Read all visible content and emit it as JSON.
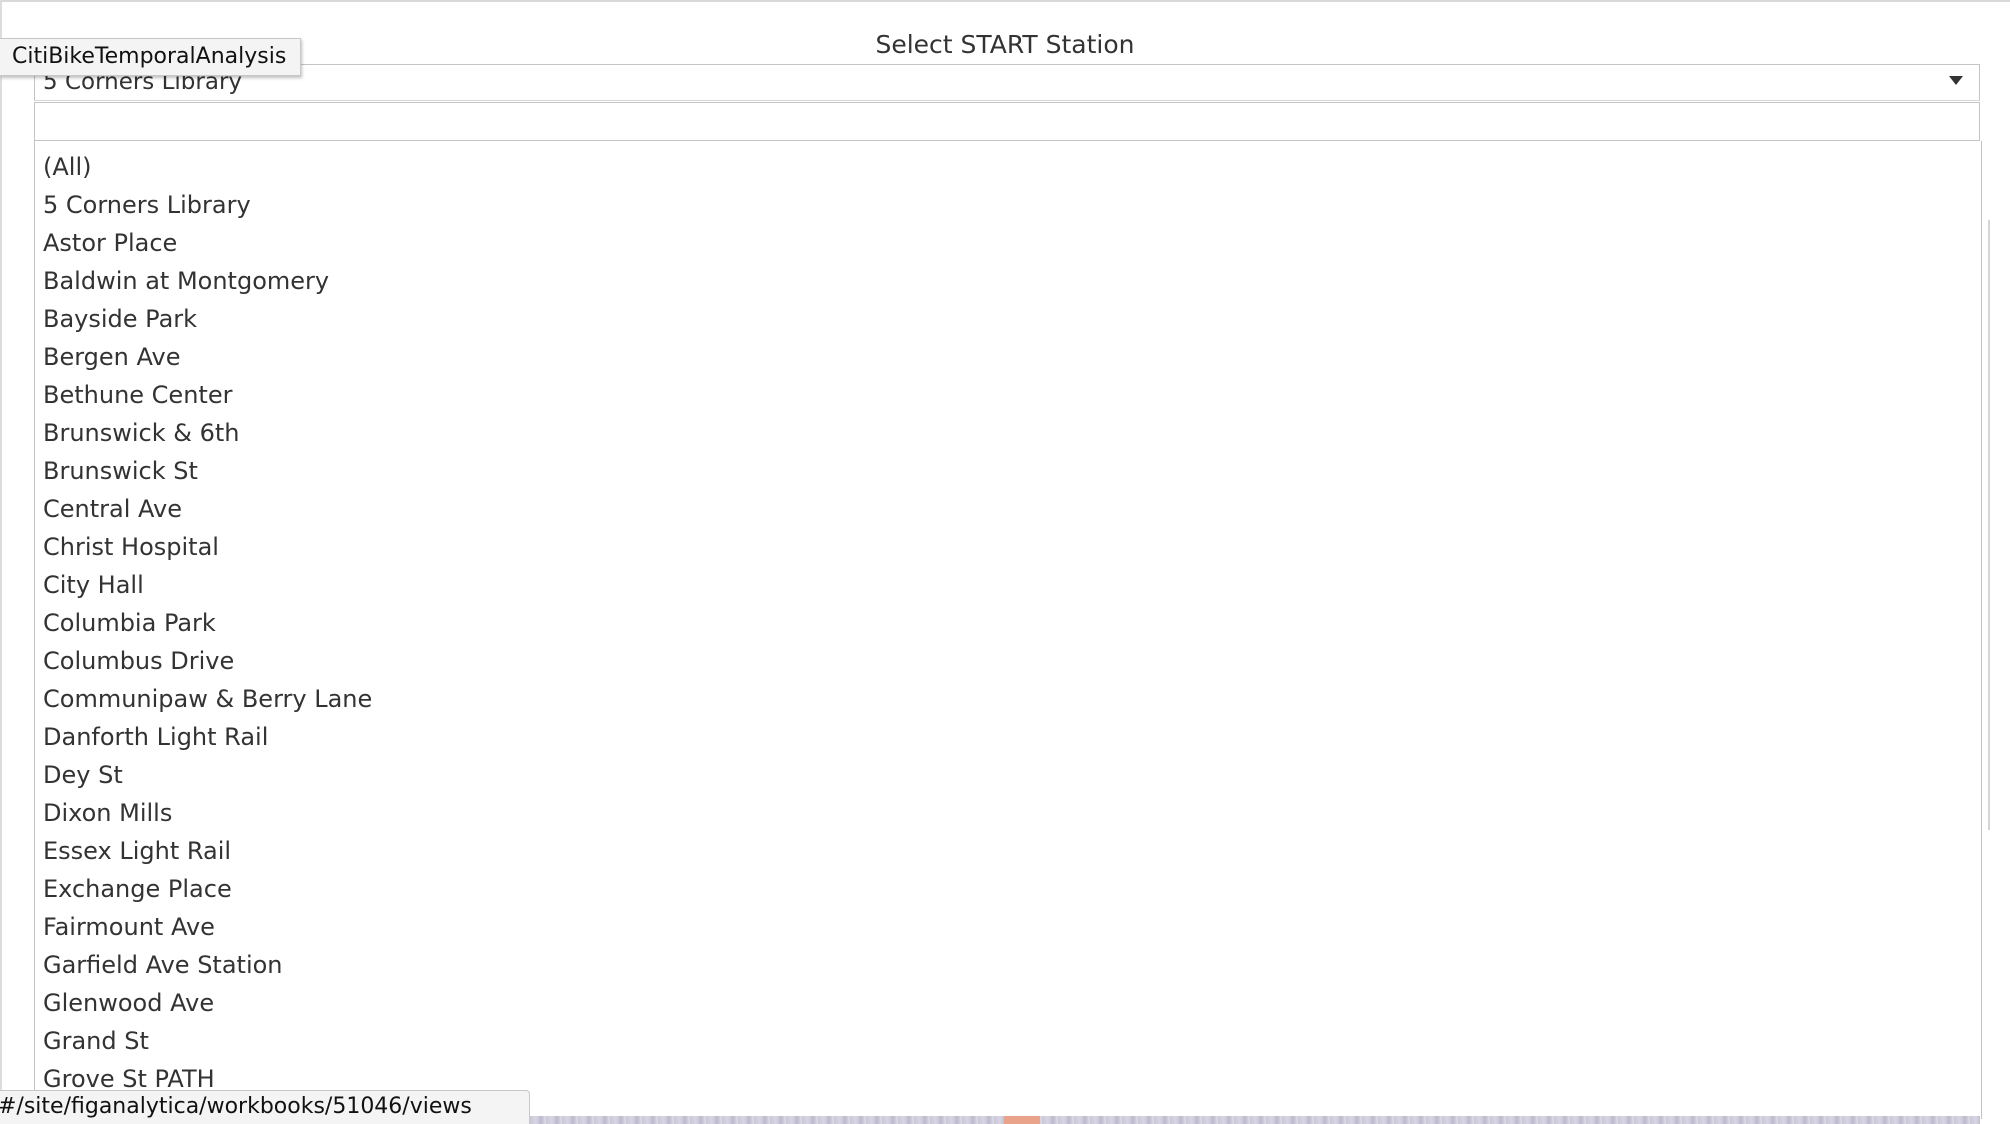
{
  "tooltip": {
    "title": "CitiBikeTemporalAnalysis"
  },
  "filter": {
    "title": "Select START Station",
    "selected_value": "5 Corners Library",
    "dropdown_icon": "triangle-down",
    "search_placeholder": "",
    "options": [
      "(All)",
      "5 Corners Library",
      "Astor Place",
      "Baldwin at Montgomery",
      "Bayside Park",
      "Bergen Ave",
      "Bethune Center",
      "Brunswick & 6th",
      "Brunswick St",
      "Central Ave",
      "Christ Hospital",
      "City Hall",
      "Columbia Park",
      "Columbus Drive",
      "Communipaw & Berry Lane",
      "Danforth Light Rail",
      "Dey St",
      "Dixon Mills",
      "Essex Light Rail",
      "Exchange Place",
      "Fairmount Ave",
      "Garfield Ave Station",
      "Glenwood Ave",
      "Grand St",
      "Grove St PATH"
    ]
  },
  "status_bar": {
    "url": "#/site/figanalytica/workbooks/51046/views"
  }
}
